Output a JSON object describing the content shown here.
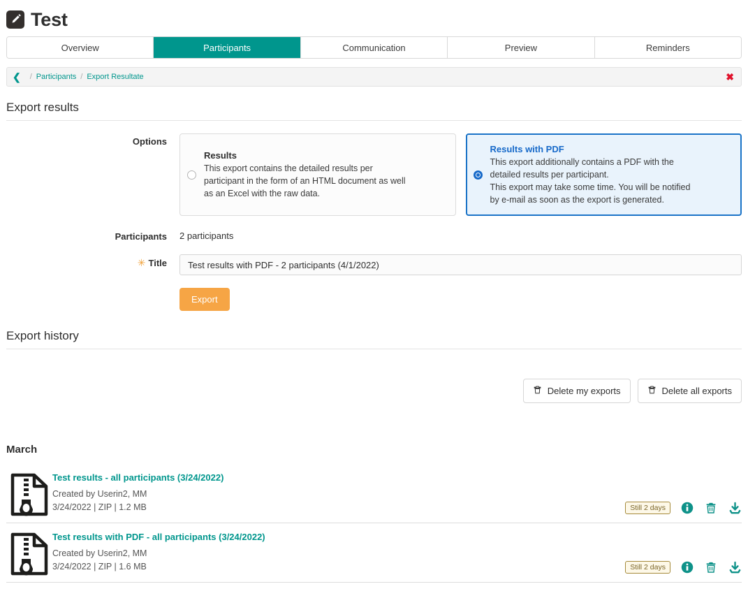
{
  "header": {
    "title": "Test",
    "icon": "pencil-icon"
  },
  "tabs": [
    {
      "label": "Overview",
      "active": false
    },
    {
      "label": "Participants",
      "active": true
    },
    {
      "label": "Communication",
      "active": false
    },
    {
      "label": "Preview",
      "active": false
    },
    {
      "label": "Reminders",
      "active": false
    }
  ],
  "breadcrumb": {
    "back_icon": "chevron-left-icon",
    "separator": "/",
    "items": [
      {
        "label": "Participants"
      },
      {
        "label": "Export Resultate"
      }
    ],
    "close_icon": "close-icon",
    "close_glyph": "✖"
  },
  "export_section": {
    "heading": "Export results",
    "options_label": "Options",
    "options": [
      {
        "title": "Results",
        "lines": [
          "This export contains the detailed results per",
          "participant in the form of an HTML document as well",
          "as an Excel with the raw data."
        ],
        "selected": false
      },
      {
        "title": "Results with PDF",
        "lines": [
          "This export additionally contains a PDF with the",
          "detailed results per participant.",
          "This export may take some time. You will be notified",
          "by e-mail as soon as the export is generated."
        ],
        "selected": true
      }
    ],
    "participants_label": "Participants",
    "participants_value": "2 participants",
    "title_label": "Title",
    "title_required_glyph": "✳",
    "title_value": "Test results with PDF - 2 participants (4/1/2022)",
    "export_button": "Export"
  },
  "history_section": {
    "heading": "Export history",
    "delete_my_exports": "Delete my exports",
    "delete_all_exports": "Delete all exports",
    "month": "March",
    "rows": [
      {
        "file_icon": "zip-file-icon",
        "title": "Test results - all participants (3/24/2022)",
        "created_by": "Created by Userin2, MM",
        "details": "3/24/2022 | ZIP | 1.2 MB",
        "badge": "Still 2 days",
        "info_icon": "info-icon",
        "delete_icon": "trash-icon",
        "download_icon": "download-icon"
      },
      {
        "file_icon": "zip-file-icon",
        "title": "Test results with PDF - all participants (3/24/2022)",
        "created_by": "Created by Userin2, MM",
        "details": "3/24/2022 | ZIP | 1.6 MB",
        "badge": "Still 2 days",
        "info_icon": "info-icon",
        "delete_icon": "trash-icon",
        "download_icon": "download-icon"
      }
    ]
  },
  "colors": {
    "teal": "#00968d",
    "orange": "#f6a545",
    "blue": "#1669c9",
    "blue_bg": "#e9f3fc",
    "badge_border": "#a58a3a",
    "close_red": "#e0112b"
  }
}
